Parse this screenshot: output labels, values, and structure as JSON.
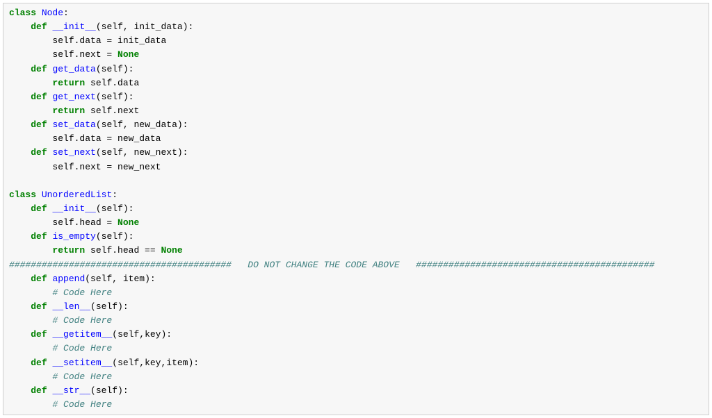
{
  "node": {
    "class_kw": "class",
    "class_name": "Node",
    "init": {
      "def": "def",
      "name": "__init__",
      "params": "(self, init_data):",
      "body1_pre": "self.data = init_data",
      "body2_pre": "self.next = ",
      "none": "None"
    },
    "get_data": {
      "def": "def",
      "name": "get_data",
      "params": "(self):",
      "ret_kw": "return",
      "ret_val": " self.data"
    },
    "get_next": {
      "def": "def",
      "name": "get_next",
      "params": "(self):",
      "ret_kw": "return",
      "ret_val": " self.next"
    },
    "set_data": {
      "def": "def",
      "name": "set_data",
      "params": "(self, new_data):",
      "body": "self.data = new_data"
    },
    "set_next": {
      "def": "def",
      "name": "set_next",
      "params": "(self, new_next):",
      "body": "self.next = new_next"
    }
  },
  "ulist": {
    "class_kw": "class",
    "class_name": "UnorderedList",
    "init": {
      "def": "def",
      "name": "__init__",
      "params": "(self):",
      "body_pre": "self.head = ",
      "none": "None"
    },
    "is_empty": {
      "def": "def",
      "name": "is_empty",
      "params": "(self):",
      "ret_kw": "return",
      "ret_mid": " self.head == ",
      "none": "None"
    },
    "sep_left": "#########################################",
    "sep_text": "   DO NOT CHANGE THE CODE ABOVE   ",
    "sep_right": "############################################",
    "append": {
      "def": "def",
      "name": "append",
      "params": "(self, item):",
      "comment": "# Code Here"
    },
    "len": {
      "def": "def",
      "name": "__len__",
      "params": "(self):",
      "comment": "# Code Here"
    },
    "getitem": {
      "def": "def",
      "name": "__getitem__",
      "params": "(self,key):",
      "comment": "# Code Here"
    },
    "setitem": {
      "def": "def",
      "name": "__setitem__",
      "params": "(self,key,item):",
      "comment": "# Code Here"
    },
    "str": {
      "def": "def",
      "name": "__str__",
      "params": "(self):",
      "comment": "# Code Here"
    }
  }
}
